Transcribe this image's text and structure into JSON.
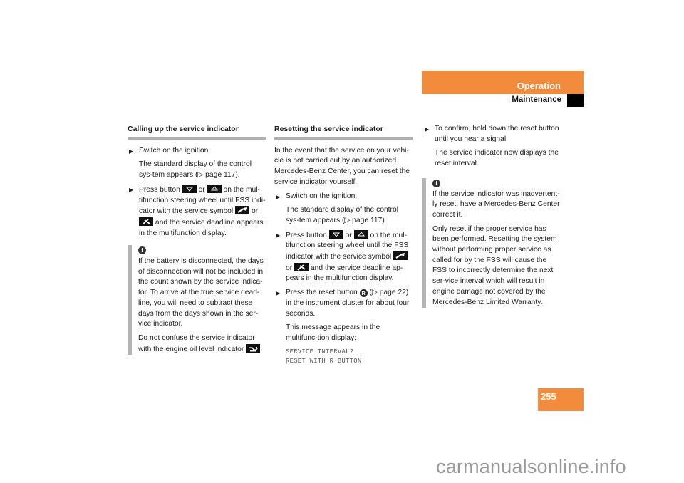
{
  "header": {
    "section": "Operation",
    "subsection": "Maintenance",
    "accent_color": "#f28c3c"
  },
  "page_number": "255",
  "col1": {
    "heading": "Calling up the service indicator",
    "step1": "Switch on the ignition.",
    "step1_result": "The standard display of the control sys-tem appears (▷ page 117).",
    "step2_a": "Press button",
    "step2_or1": "or",
    "step2_b": "on the mul-tifunction steering wheel until FSS indi-cator with the service symbol",
    "step2_or2": "or",
    "step2_c": "and the service deadline appears in the multifunction display.",
    "info_icon": "i",
    "info_p1": "If the battery is disconnected, the days of disconnection will not be included in the count shown by the service indica-tor. To arrive at the true service dead-line, you will need to subtract these days from the days shown in the ser-vice indicator.",
    "info_p2": "Do not confuse the service indicator with the engine oil level indicator",
    "info_p2_end": "."
  },
  "col2": {
    "heading": "Resetting the service indicator",
    "intro": "In the event that the service on your vehi-cle is not carried out by an authorized Mercedes-Benz Center, you can reset the service indicator yourself.",
    "step1": "Switch on the ignition.",
    "step1_result": "The standard display of the control sys-tem appears (▷ page 117).",
    "step2_a": "Press button",
    "step2_or1": "or",
    "step2_b": "on the mul-tifunction steering wheel until the FSS indicator with the service symbol",
    "step2_or2": "or",
    "step2_c": "and the service deadline ap-pears in the multifunction display.",
    "step3_a": "Press the reset button",
    "step3_r": "R",
    "step3_b": "(▷ page 22) in the instrument cluster for about four seconds.",
    "step3_result": "This message appears in the multifunc-tion display:",
    "display_line1": "SERVICE INTERVAL?",
    "display_line2": "RESET WITH R BUTTON"
  },
  "col3": {
    "step1": "To confirm, hold down the reset button until you hear a signal.",
    "step1_result": "The service indicator now displays the reset interval.",
    "info_icon": "i",
    "info_p1": "If the service indicator was inadvertent-ly reset, have a Mercedes-Benz Center correct it.",
    "info_p2": "Only reset if the proper service has been performed. Resetting the system without performing proper service as called for by the FSS will cause the FSS to incorrectly determine the next ser-vice interval which will result in engine damage not covered by the Mercedes-Benz Limited Warranty."
  },
  "bullet_glyph": "▶",
  "watermark": "carmanualsonline.info"
}
